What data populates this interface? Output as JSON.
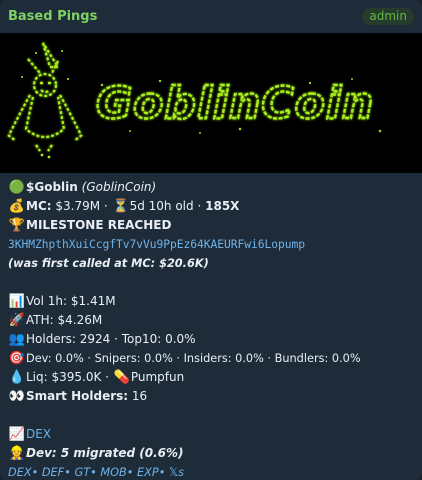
{
  "header": {
    "sender": "Based Pings",
    "role_badge": "admin"
  },
  "banner": {
    "logo_text": "GoblinCoin"
  },
  "message": {
    "ticker": "$Goblin",
    "name": "(GoblinCoin)",
    "mc_label": "MC:",
    "mc_value": "$3.79M",
    "age_sep": "·",
    "age": "5d 10h old",
    "multiplier": "185X",
    "milestone": "MILESTONE REACHED",
    "contract": "3KHMZhpthXuiCcgfTv7vVu9PpEz64KAEURFwi6Lopump",
    "first_called": "(was first called at MC: $20.6K)",
    "vol": "Vol 1h: $1.41M",
    "ath": "ATH: $4.26M",
    "holders": "Holders: 2924 · Top10: 0.0%",
    "dev_stats": "Dev: 0.0% · Snipers: 0.0% · Insiders: 0.0% · Bundlers: 0.0%",
    "liq": "Liq: $395.0K ·",
    "platform": "Pumpfun",
    "smart_holders_label": "Smart Holders:",
    "smart_holders_value": "16",
    "dex_link": "DEX",
    "dev_migrated": "Dev: 5 migrated (0.6%)",
    "footer_links": [
      "DEX",
      "DEF",
      "GT",
      "MOB",
      "EXP",
      "𝕏s"
    ]
  }
}
